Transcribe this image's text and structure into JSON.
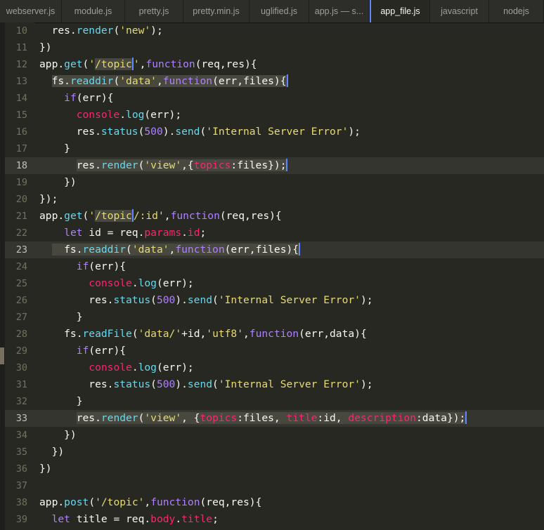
{
  "tabs": [
    {
      "label": "webserver.js",
      "width": 88,
      "active": false
    },
    {
      "label": "module.js",
      "width": 90,
      "active": false
    },
    {
      "label": "pretty.js",
      "width": 83,
      "active": false
    },
    {
      "label": "pretty.min.js",
      "width": 94,
      "active": false
    },
    {
      "label": "uglified.js",
      "width": 85,
      "active": false
    },
    {
      "label": "app.js — s...",
      "width": 86,
      "active": false
    },
    {
      "label": "app_file.js",
      "width": 86,
      "active": true
    },
    {
      "label": "javascript",
      "width": 84,
      "active": false
    },
    {
      "label": "nodejs",
      "width": 78,
      "active": false
    }
  ],
  "colors": {
    "background": "#272822",
    "keyword": "#ae81ff",
    "method": "#66d9ef",
    "string": "#e6db74",
    "number": "#ae81ff",
    "property": "#f92672",
    "cursor": "#5f87ff"
  },
  "lines": [
    {
      "n": "10",
      "hl": false,
      "code": [
        [
          "  res.",
          ""
        ],
        [
          "render",
          "f"
        ],
        [
          "(",
          ""
        ],
        [
          "'new'",
          "s"
        ],
        [
          ");",
          ""
        ]
      ]
    },
    {
      "n": "11",
      "hl": false,
      "code": [
        [
          "})",
          ""
        ]
      ]
    },
    {
      "n": "12",
      "hl": false,
      "code": [
        [
          "app.",
          ""
        ],
        [
          "get",
          "f"
        ],
        [
          "(",
          ""
        ],
        [
          "'",
          "s"
        ],
        [
          "/topic",
          "s sel"
        ],
        [
          "|",
          "cursor"
        ],
        [
          "'",
          "s"
        ],
        [
          ",",
          ""
        ],
        [
          "function",
          "kw"
        ],
        [
          "(req,res){",
          ""
        ]
      ]
    },
    {
      "n": "13",
      "hl": false,
      "code": [
        [
          "  ",
          ""
        ],
        [
          "fs.",
          "sel"
        ],
        [
          "readdir",
          "f sel"
        ],
        [
          "(",
          "sel"
        ],
        [
          "'data'",
          "s sel"
        ],
        [
          ",",
          "sel"
        ],
        [
          "function",
          "kw sel"
        ],
        [
          "(err,files){",
          "sel"
        ],
        [
          "|",
          "cursor"
        ]
      ]
    },
    {
      "n": "14",
      "hl": false,
      "code": [
        [
          "    ",
          ""
        ],
        [
          "if",
          "kw"
        ],
        [
          "(err){",
          ""
        ]
      ]
    },
    {
      "n": "15",
      "hl": false,
      "code": [
        [
          "      ",
          ""
        ],
        [
          "console",
          "k"
        ],
        [
          ".",
          ""
        ],
        [
          "log",
          "f"
        ],
        [
          "(err);",
          ""
        ]
      ]
    },
    {
      "n": "16",
      "hl": false,
      "code": [
        [
          "      res.",
          ""
        ],
        [
          "status",
          "f"
        ],
        [
          "(",
          ""
        ],
        [
          "500",
          "n"
        ],
        [
          ").",
          ""
        ],
        [
          "send",
          "f"
        ],
        [
          "(",
          ""
        ],
        [
          "'Internal Server Error'",
          "s"
        ],
        [
          ");",
          ""
        ]
      ]
    },
    {
      "n": "17",
      "hl": false,
      "code": [
        [
          "    }",
          ""
        ]
      ]
    },
    {
      "n": "18",
      "hl": true,
      "code": [
        [
          "      ",
          ""
        ],
        [
          "res.",
          "sel"
        ],
        [
          "render",
          "f sel"
        ],
        [
          "(",
          "sel"
        ],
        [
          "'view'",
          "s sel"
        ],
        [
          ",{",
          "sel"
        ],
        [
          "topics",
          "k sel"
        ],
        [
          ":files});",
          "sel"
        ],
        [
          "|",
          "cursor"
        ]
      ]
    },
    {
      "n": "19",
      "hl": false,
      "code": [
        [
          "    })",
          ""
        ]
      ]
    },
    {
      "n": "20",
      "hl": false,
      "code": [
        [
          "});",
          ""
        ]
      ]
    },
    {
      "n": "21",
      "hl": false,
      "code": [
        [
          "app.",
          ""
        ],
        [
          "get",
          "f"
        ],
        [
          "(",
          ""
        ],
        [
          "'",
          "s"
        ],
        [
          "/topic",
          "s sel"
        ],
        [
          "|",
          "cursor"
        ],
        [
          "/:id'",
          "s"
        ],
        [
          ",",
          ""
        ],
        [
          "function",
          "kw"
        ],
        [
          "(req,res){",
          ""
        ]
      ]
    },
    {
      "n": "22",
      "hl": false,
      "code": [
        [
          "    ",
          ""
        ],
        [
          "let",
          "kw"
        ],
        [
          " id = req.",
          ""
        ],
        [
          "params",
          "k"
        ],
        [
          ".",
          ""
        ],
        [
          "id",
          "k"
        ],
        [
          ";",
          ""
        ]
      ]
    },
    {
      "n": "23",
      "hl": true,
      "code": [
        [
          "  ",
          ""
        ],
        [
          "  fs.",
          "sel"
        ],
        [
          "readdir",
          "f sel"
        ],
        [
          "(",
          "sel"
        ],
        [
          "'data'",
          "s sel"
        ],
        [
          ",",
          "sel"
        ],
        [
          "function",
          "kw sel"
        ],
        [
          "(err,files){",
          "sel"
        ],
        [
          "|",
          "cursor"
        ]
      ]
    },
    {
      "n": "24",
      "hl": false,
      "code": [
        [
          "      ",
          ""
        ],
        [
          "if",
          "kw"
        ],
        [
          "(err){",
          ""
        ]
      ]
    },
    {
      "n": "25",
      "hl": false,
      "code": [
        [
          "        ",
          ""
        ],
        [
          "console",
          "k"
        ],
        [
          ".",
          ""
        ],
        [
          "log",
          "f"
        ],
        [
          "(err);",
          ""
        ]
      ]
    },
    {
      "n": "26",
      "hl": false,
      "code": [
        [
          "        res.",
          ""
        ],
        [
          "status",
          "f"
        ],
        [
          "(",
          ""
        ],
        [
          "500",
          "n"
        ],
        [
          ").",
          ""
        ],
        [
          "send",
          "f"
        ],
        [
          "(",
          ""
        ],
        [
          "'Internal Server Error'",
          "s"
        ],
        [
          ");",
          ""
        ]
      ]
    },
    {
      "n": "27",
      "hl": false,
      "code": [
        [
          "      }",
          ""
        ]
      ]
    },
    {
      "n": "28",
      "hl": false,
      "code": [
        [
          "    fs.",
          ""
        ],
        [
          "readFile",
          "f"
        ],
        [
          "(",
          ""
        ],
        [
          "'data/'",
          "s"
        ],
        [
          "+id,",
          ""
        ],
        [
          "'utf8'",
          "s"
        ],
        [
          ",",
          ""
        ],
        [
          "function",
          "kw"
        ],
        [
          "(err,data){",
          ""
        ]
      ]
    },
    {
      "n": "29",
      "hl": false,
      "code": [
        [
          "      ",
          ""
        ],
        [
          "if",
          "kw"
        ],
        [
          "(err){",
          ""
        ]
      ]
    },
    {
      "n": "30",
      "hl": false,
      "code": [
        [
          "        ",
          ""
        ],
        [
          "console",
          "k"
        ],
        [
          ".",
          ""
        ],
        [
          "log",
          "f"
        ],
        [
          "(err);",
          ""
        ]
      ]
    },
    {
      "n": "31",
      "hl": false,
      "code": [
        [
          "        res.",
          ""
        ],
        [
          "status",
          "f"
        ],
        [
          "(",
          ""
        ],
        [
          "500",
          "n"
        ],
        [
          ").",
          ""
        ],
        [
          "send",
          "f"
        ],
        [
          "(",
          ""
        ],
        [
          "'Internal Server Error'",
          "s"
        ],
        [
          ");",
          ""
        ]
      ]
    },
    {
      "n": "32",
      "hl": false,
      "code": [
        [
          "      }",
          ""
        ]
      ]
    },
    {
      "n": "33",
      "hl": true,
      "code": [
        [
          "      ",
          ""
        ],
        [
          "res.",
          "sel"
        ],
        [
          "render",
          "f sel"
        ],
        [
          "(",
          "sel"
        ],
        [
          "'view'",
          "s sel"
        ],
        [
          ", {",
          "sel"
        ],
        [
          "topics",
          "k sel"
        ],
        [
          ":files, ",
          "sel"
        ],
        [
          "title",
          "k sel"
        ],
        [
          ":id, ",
          "sel"
        ],
        [
          "description",
          "k sel"
        ],
        [
          ":data});",
          "sel"
        ],
        [
          "|",
          "cursor"
        ]
      ]
    },
    {
      "n": "34",
      "hl": false,
      "code": [
        [
          "    })",
          ""
        ]
      ]
    },
    {
      "n": "35",
      "hl": false,
      "code": [
        [
          "  })",
          ""
        ]
      ]
    },
    {
      "n": "36",
      "hl": false,
      "code": [
        [
          "})",
          ""
        ]
      ]
    },
    {
      "n": "37",
      "hl": false,
      "code": []
    },
    {
      "n": "38",
      "hl": false,
      "code": [
        [
          "app.",
          ""
        ],
        [
          "post",
          "f"
        ],
        [
          "(",
          ""
        ],
        [
          "'/topic'",
          "s"
        ],
        [
          ",",
          ""
        ],
        [
          "function",
          "kw"
        ],
        [
          "(req,res){",
          ""
        ]
      ]
    },
    {
      "n": "39",
      "hl": false,
      "code": [
        [
          "  ",
          ""
        ],
        [
          "let",
          "kw"
        ],
        [
          " title = req.",
          ""
        ],
        [
          "body",
          "k"
        ],
        [
          ".",
          ""
        ],
        [
          "title",
          "k"
        ],
        [
          ";",
          ""
        ]
      ]
    }
  ]
}
